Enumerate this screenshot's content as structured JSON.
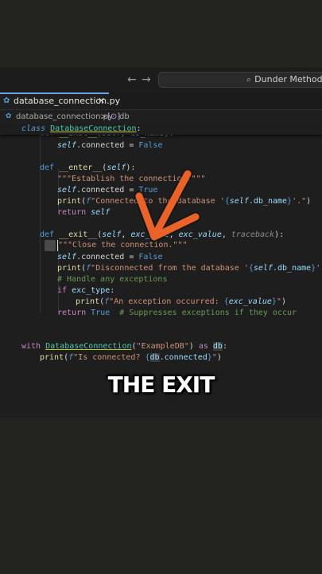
{
  "window": {
    "back_icon": "arrow-left-icon",
    "forward_icon": "arrow-right-icon",
    "search_text": "Dunder Methods"
  },
  "tab": {
    "label": "database_connection.py",
    "close": "✕"
  },
  "breadcrumb": {
    "file": "database_connection.py",
    "separator": ">",
    "symbol_icon": "[⊙]",
    "symbol": "db"
  },
  "code": {
    "sticky": {
      "kw": "class",
      "name": "DatabaseConnection",
      "tail": ":"
    },
    "init_partial": {
      "def": "def",
      "name": "__init__",
      "p1": "(self, ",
      "p2": "db_name",
      "p3": "):"
    },
    "l_connected_false": {
      "self": "self",
      "rest": ".connected = ",
      "val": "False"
    },
    "enter_def": {
      "def": "def",
      "name": "__enter__",
      "open": "(",
      "self": "self",
      "close": "):"
    },
    "enter_doc": "\"\"\"Establish the connection.\"\"\"",
    "enter_set": {
      "self": "self",
      "rest": ".connected = ",
      "val": "True"
    },
    "enter_print": {
      "fn": "print",
      "f": "f",
      "s1": "\"Connected to the database '",
      "b1": "{",
      "self": "self",
      "attr": ".db_name",
      "b2": "}",
      "s2": "'.\"",
      "end": ")"
    },
    "enter_ret": {
      "kw": "return",
      "self": "self"
    },
    "exit_def": {
      "def": "def",
      "name": "__exit__",
      "open": "(",
      "self": "self",
      "c1": ", ",
      "p1": "exc_type",
      "c2": ", ",
      "p2": "exc_value",
      "c3": ", ",
      "p3": "traceback",
      "close": "):"
    },
    "exit_doc": "\"\"\"Close the connection.\"\"\"",
    "exit_set": {
      "self": "self",
      "rest": ".connected = ",
      "val": "False"
    },
    "exit_print": {
      "fn": "print",
      "f": "f",
      "s1": "\"Disconnected from the database '",
      "b1": "{",
      "self": "self",
      "attr": ".db_name",
      "b2": "}",
      "s2": "'.\"",
      "end": ")"
    },
    "exit_comment": "# Handle any exceptions",
    "exit_if": {
      "kw": "if",
      "var": "exc_type",
      "tail": ":"
    },
    "exit_print2": {
      "fn": "print",
      "f": "f",
      "s1": "\"An exception occurred: ",
      "b1": "{",
      "var": "exc_value",
      "b2": "}",
      "s2": "\"",
      "end": ")"
    },
    "exit_ret": {
      "kw": "return",
      "val": "True",
      "cmt": "# Suppresses exceptions if they occur"
    },
    "with_line": {
      "kw": "with",
      "cls": "DatabaseConnection",
      "open": "(",
      "str": "\"ExampleDB\"",
      "close": ")",
      "as": "as",
      "var": "db",
      "tail": ":"
    },
    "with_print": {
      "fn": "print",
      "f": "f",
      "s1": "\"Is connected? ",
      "b1": "{",
      "var": "db",
      "attr": ".connected",
      "b2": "}",
      "s2": "\"",
      "end": ")"
    }
  },
  "overlay": {
    "caption": "THE EXIT",
    "arrow_color": "#e8622a"
  }
}
